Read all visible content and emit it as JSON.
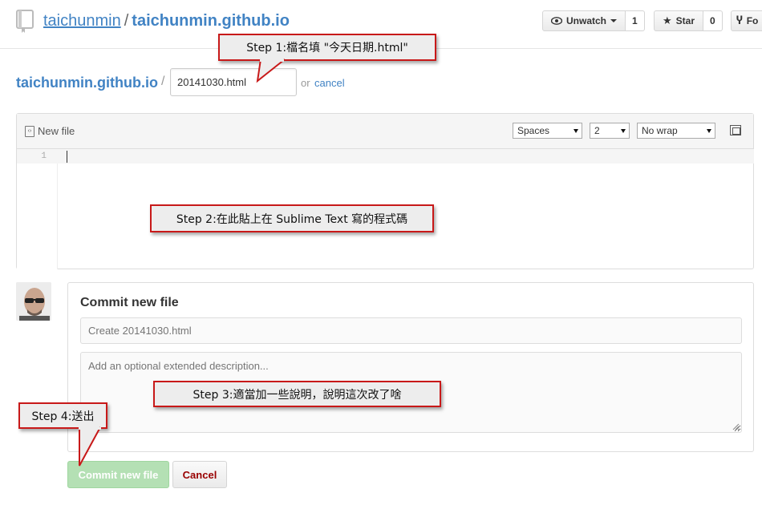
{
  "header": {
    "owner": "taichunmin",
    "separator": "/",
    "repo": "taichunmin.github.io",
    "watch_label": "Unwatch",
    "watch_count": "1",
    "star_label": "Star",
    "star_count": "0",
    "fork_label": "Fo"
  },
  "breadcrumb": {
    "repo": "taichunmin.github.io",
    "separator": "/",
    "filename_value": "20141030.html",
    "or_text": "or",
    "cancel_label": "cancel"
  },
  "editor": {
    "tab_label": "New file",
    "indent_mode": "Spaces",
    "indent_size": "2",
    "wrap_mode": "No wrap",
    "line_number": "1"
  },
  "commit": {
    "title": "Commit new file",
    "summary_placeholder": "Create 20141030.html",
    "description_placeholder": "Add an optional extended description...",
    "submit_label": "Commit new file",
    "cancel_label": "Cancel"
  },
  "callouts": {
    "step1": "Step 1:檔名填 \"今天日期.html\"",
    "step2": "Step 2:在此貼上在 Sublime Text 寫的程式碼",
    "step3": "Step 3:適當加一些說明，說明這次改了啥",
    "step4": "Step 4:送出"
  },
  "colors": {
    "link": "#4183c4",
    "callout_border": "#c81919",
    "commit_button": "#a8dba8"
  }
}
